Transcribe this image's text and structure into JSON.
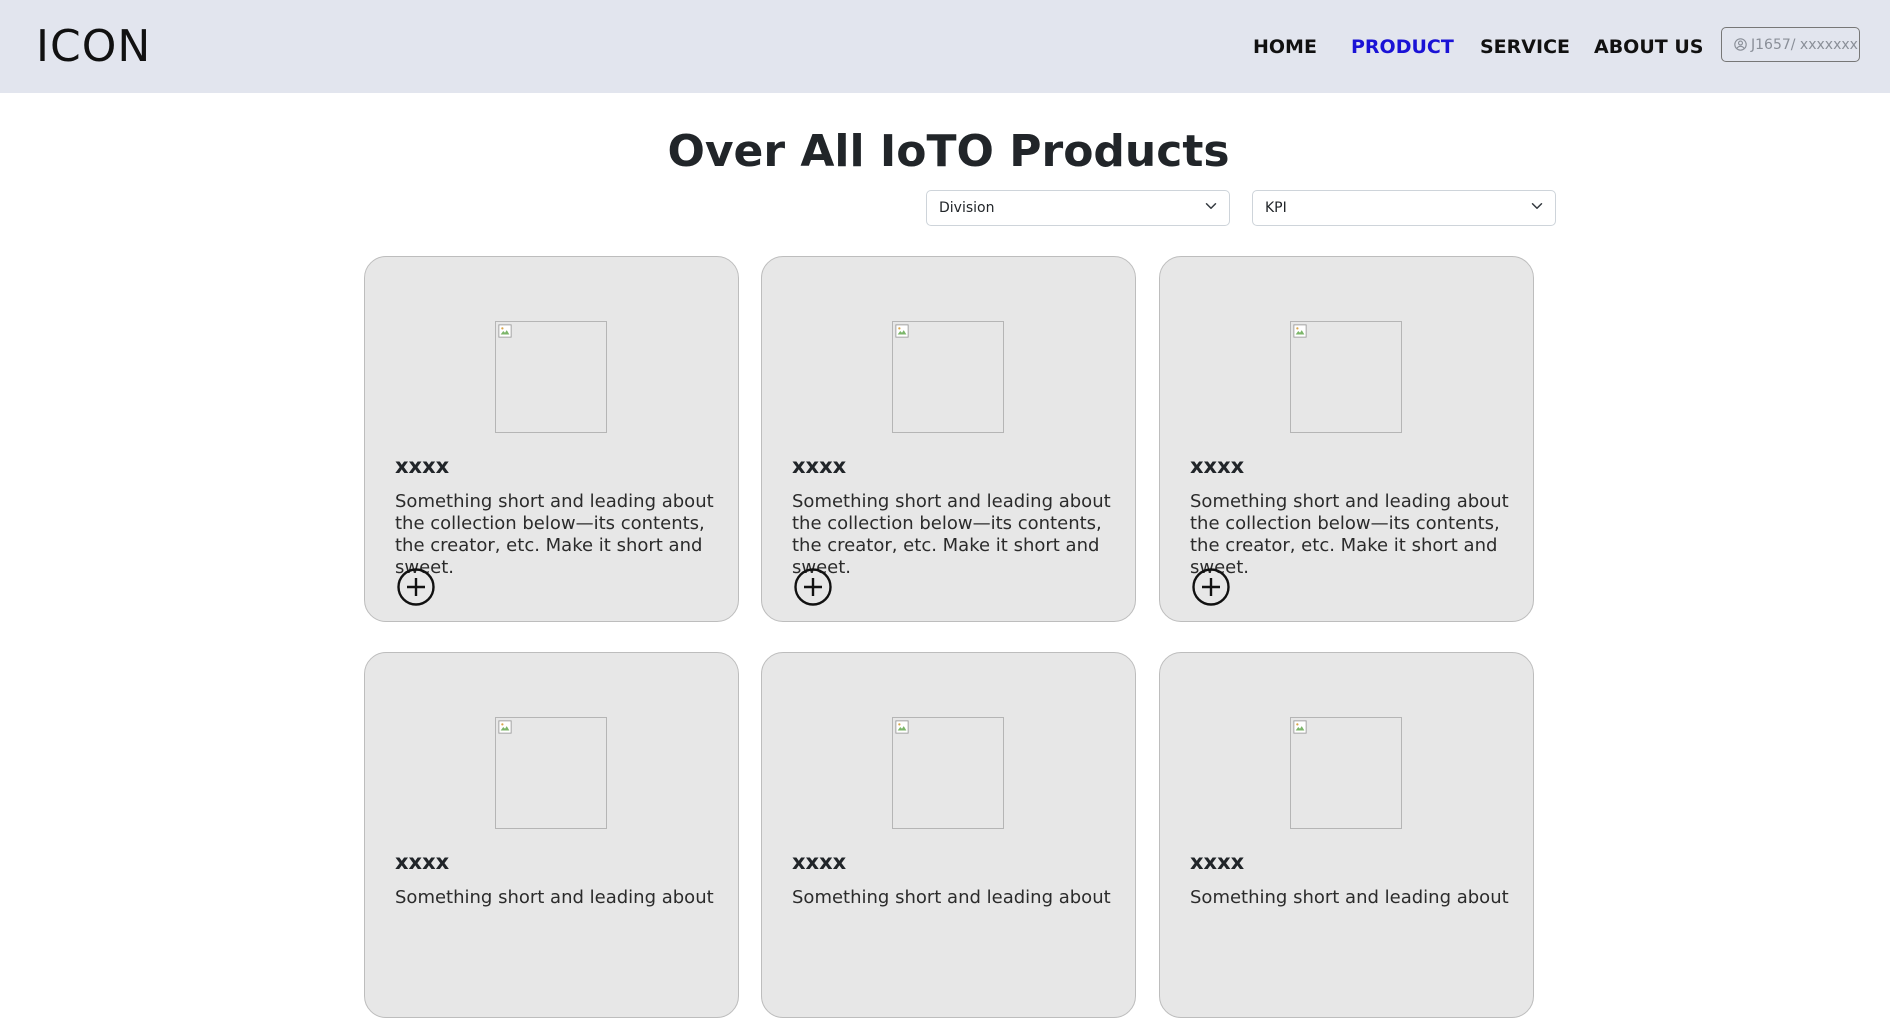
{
  "navbar": {
    "brand": "ICON",
    "links": [
      {
        "label": "HOME",
        "active": false
      },
      {
        "label": "PRODUCT",
        "active": true
      },
      {
        "label": "SERVICE",
        "active": false
      },
      {
        "label": "ABOUT US",
        "active": false
      }
    ],
    "user_field": {
      "value": "J1657/ xxxxxxx",
      "icon": "user-circle-icon"
    }
  },
  "main": {
    "title": "Over All IoTO Products",
    "filters": [
      {
        "name": "division",
        "selected": "Division",
        "icon": "chevron-down-icon"
      },
      {
        "name": "kpi",
        "selected": "KPI",
        "icon": "chevron-down-icon"
      }
    ],
    "cards": [
      {
        "title": "xxxx",
        "text": "Something short and leading about the collection below—its contents, the creator, etc. Make it short and sweet.",
        "action_icon": "plus-circle-icon"
      },
      {
        "title": "xxxx",
        "text": "Something short and leading about the collection below—its contents, the creator, etc. Make it short and sweet.",
        "action_icon": "plus-circle-icon"
      },
      {
        "title": "xxxx",
        "text": "Something short and leading about the collection below—its contents, the creator, etc. Make it short and sweet.",
        "action_icon": "plus-circle-icon"
      },
      {
        "title": "xxxx",
        "text": "Something short and leading about",
        "action_icon": "plus-circle-icon"
      },
      {
        "title": "xxxx",
        "text": "Something short and leading about",
        "action_icon": "plus-circle-icon"
      },
      {
        "title": "xxxx",
        "text": "Something short and leading about",
        "action_icon": "plus-circle-icon"
      }
    ]
  },
  "colors": {
    "navbar_bg": "#e2e5ee",
    "active_link": "#1a12d6",
    "card_bg": "#e7e7e7"
  }
}
